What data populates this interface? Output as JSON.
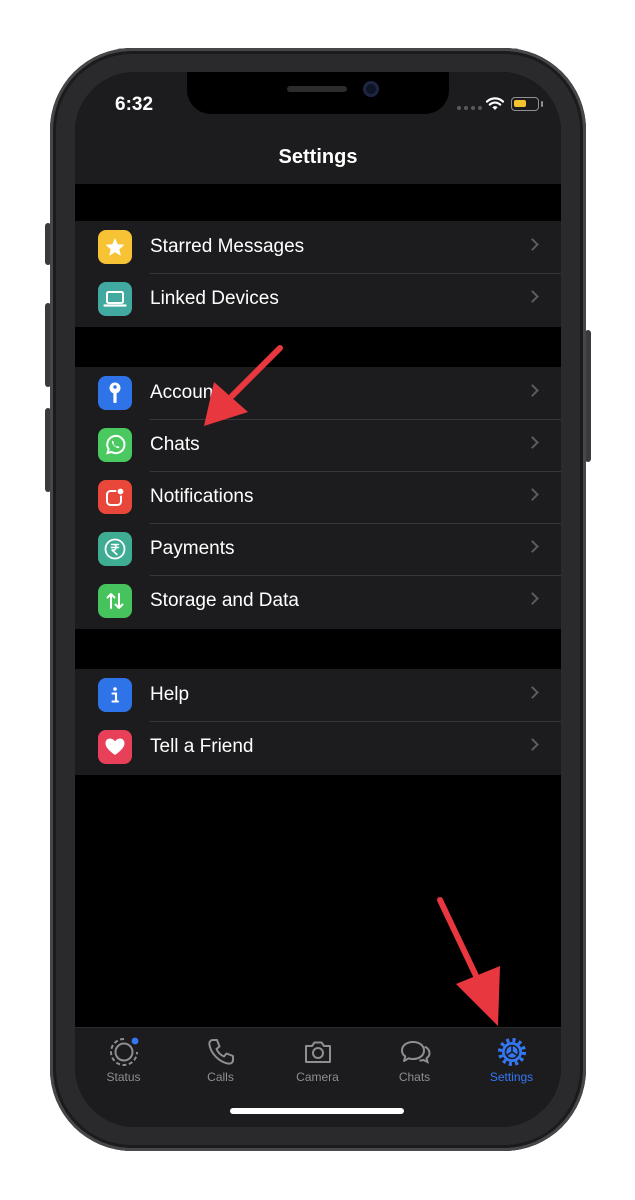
{
  "status_bar": {
    "time": "6:32"
  },
  "header": {
    "title": "Settings"
  },
  "groups": [
    {
      "items": [
        {
          "label": "Starred Messages",
          "icon": "star-icon",
          "color": "#f7c334"
        },
        {
          "label": "Linked Devices",
          "icon": "laptop-icon",
          "color": "#41a99f"
        }
      ]
    },
    {
      "items": [
        {
          "label": "Account",
          "icon": "key-icon",
          "color": "#2f73e9"
        },
        {
          "label": "Chats",
          "icon": "whatsapp-icon",
          "color": "#49c95f"
        },
        {
          "label": "Notifications",
          "icon": "notification-badge-icon",
          "color": "#e8473a"
        },
        {
          "label": "Payments",
          "icon": "rupee-icon",
          "color": "#3fac94"
        },
        {
          "label": "Storage and Data",
          "icon": "arrows-up-down-icon",
          "color": "#46c35c"
        }
      ]
    },
    {
      "items": [
        {
          "label": "Help",
          "icon": "info-icon",
          "color": "#2f73e9"
        },
        {
          "label": "Tell a Friend",
          "icon": "heart-icon",
          "color": "#e74058"
        }
      ]
    }
  ],
  "tabbar": {
    "tabs": [
      {
        "label": "Status",
        "icon": "status-icon"
      },
      {
        "label": "Calls",
        "icon": "phone-icon"
      },
      {
        "label": "Camera",
        "icon": "camera-icon"
      },
      {
        "label": "Chats",
        "icon": "chat-bubbles-icon"
      },
      {
        "label": "Settings",
        "icon": "gear-icon",
        "active": true
      }
    ],
    "active_color": "#3478f6"
  },
  "annotations": {
    "arrow_color": "#e8373e"
  }
}
